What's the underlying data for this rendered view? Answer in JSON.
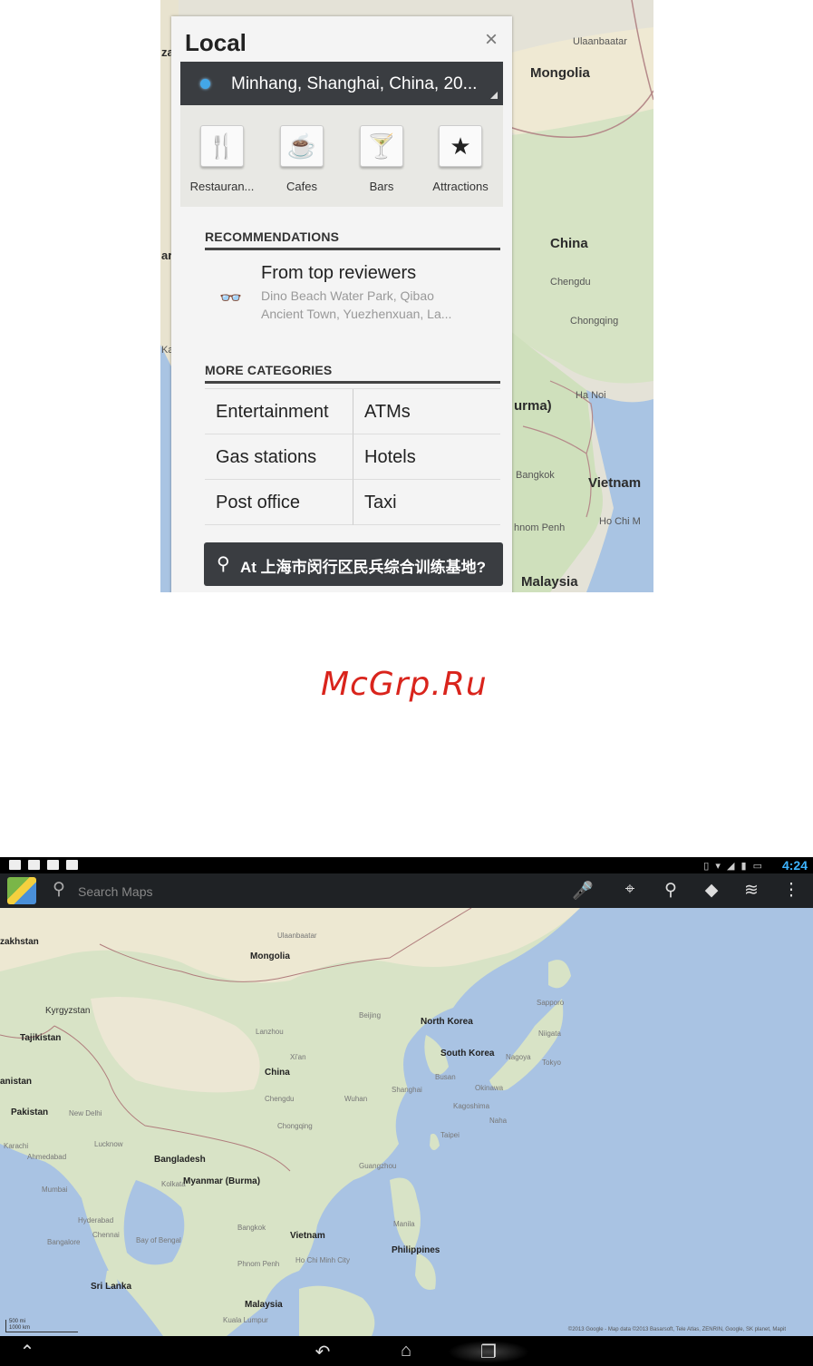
{
  "local_panel": {
    "title": "Local",
    "close_glyph": "×",
    "location": "Minhang, Shanghai, China, 20...",
    "categories": [
      {
        "label": "Restauran...",
        "icon": "fork-knife-icon",
        "glyph": "🍴"
      },
      {
        "label": "Cafes",
        "icon": "coffee-cup-icon",
        "glyph": "☕"
      },
      {
        "label": "Bars",
        "icon": "cocktail-icon",
        "glyph": "🍸"
      },
      {
        "label": "Attractions",
        "icon": "ticket-star-icon",
        "glyph": "★"
      }
    ],
    "recommendations": {
      "heading": "RECOMMENDATIONS",
      "item": {
        "icon": "glasses-icon",
        "glyph": "👓",
        "title": "From top reviewers",
        "subtitle_line1": "Dino Beach Water Park, Qibao",
        "subtitle_line2": "Ancient Town, Yuezhenxuan, La..."
      }
    },
    "more_categories": {
      "heading": "MORE CATEGORIES",
      "items": [
        "Entertainment",
        "ATMs",
        "Gas stations",
        "Hotels",
        "Post office",
        "Taxi"
      ]
    },
    "at_location": "At 上海市闵行区民兵综合训练基地?",
    "pin_glyph": "⚲"
  },
  "map1_labels": {
    "ulaanbaatar": "Ulaanbaatar",
    "mongolia": "Mongolia",
    "china": "China",
    "chengdu": "Chengdu",
    "chongqing": "Chongqing",
    "hanoi": "Ha Noi",
    "myanmar": "urma)",
    "bangkok": "Bangkok",
    "vietnam": "Vietnam",
    "phnom_penh": "hnom Penh",
    "ho_chi_minh": "Ho Chi M",
    "malaysia": "Malaysia",
    "left_za": "za",
    "left_ar": "ar",
    "left_ka": "Ka"
  },
  "watermark": "McGrp.Ru",
  "tablet": {
    "status": {
      "time": "4:24",
      "right_icons": "▯ ▾ ◢ ▮ ▭"
    },
    "search_placeholder": "Search Maps",
    "action_buttons": [
      {
        "name": "voice-search-button",
        "icon": "mic-icon",
        "glyph": "🎤"
      },
      {
        "name": "my-location-button",
        "icon": "target-icon",
        "glyph": "⌖"
      },
      {
        "name": "places-button",
        "icon": "places-pin-icon",
        "glyph": "⚲"
      },
      {
        "name": "directions-button",
        "icon": "directions-icon",
        "glyph": "◆"
      },
      {
        "name": "layers-button",
        "icon": "layers-icon",
        "glyph": "≋"
      },
      {
        "name": "overflow-menu-button",
        "icon": "more-vert-icon",
        "glyph": "⋮"
      }
    ],
    "map_labels": {
      "kazakhstan": "zakhstan",
      "mongolia": "Mongolia",
      "kyrgyzstan": "Kyrgyzstan",
      "tajikistan": "Tajikistan",
      "afghanistan": "anistan",
      "pakistan": "Pakistan",
      "china": "China",
      "beijing": "Beijing",
      "north_korea": "North Korea",
      "south_korea": "South Korea",
      "sapporo": "Sapporo",
      "niigata": "Niigata",
      "nagoya": "Nagoya",
      "tokyo": "Tokyo",
      "busan": "Busan",
      "okinawa": "Okinawa",
      "kagoshima": "Kagoshima",
      "shanghai": "Shanghai",
      "wuhan": "Wuhan",
      "chengdu": "Chengdu",
      "chongqing": "Chongqing",
      "new_delhi": "New Delhi",
      "lucknow": "Lucknow",
      "kolkata": "Kolkata",
      "bangladesh": "Bangladesh",
      "myanmar": "Myanmar (Burma)",
      "mumbai": "Mumbai",
      "hyderabad": "Hyderabad",
      "chennai": "Chennai",
      "bay_of_bengal": "Bay of Bengal",
      "bangalore": "Bangalore",
      "bangkok": "Bangkok",
      "vietnam": "Vietnam",
      "phnom_penh": "Phnom Penh",
      "ho_chi_minh": "Ho Chi Minh City",
      "philippines": "Philippines",
      "manila": "Manila",
      "sri_lanka": "Sri Lanka",
      "malaysia": "Malaysia",
      "kuala_lumpur": "Kuala Lumpur",
      "guangzhou": "Guangzhou",
      "naha": "Naha",
      "taipei": "Taipei",
      "xian": "Xi'an",
      "karachi": "Karachi",
      "ahmedabad": "Ahmedabad",
      "lanzhou": "Lanzhou",
      "ulaanbaatar": "Ulaanbaatar"
    },
    "attribution": "©2013 Google - Map data ©2013 Basarsoft, Tele Atlas, ZENRIN, Google, SK planet, Mapit",
    "scale": {
      "top": "500 mi",
      "bottom": "1000 km"
    },
    "nav": {
      "back_glyph": "↶",
      "home_glyph": "⌂",
      "recent_glyph": "❐",
      "up_glyph": "⌃"
    }
  }
}
